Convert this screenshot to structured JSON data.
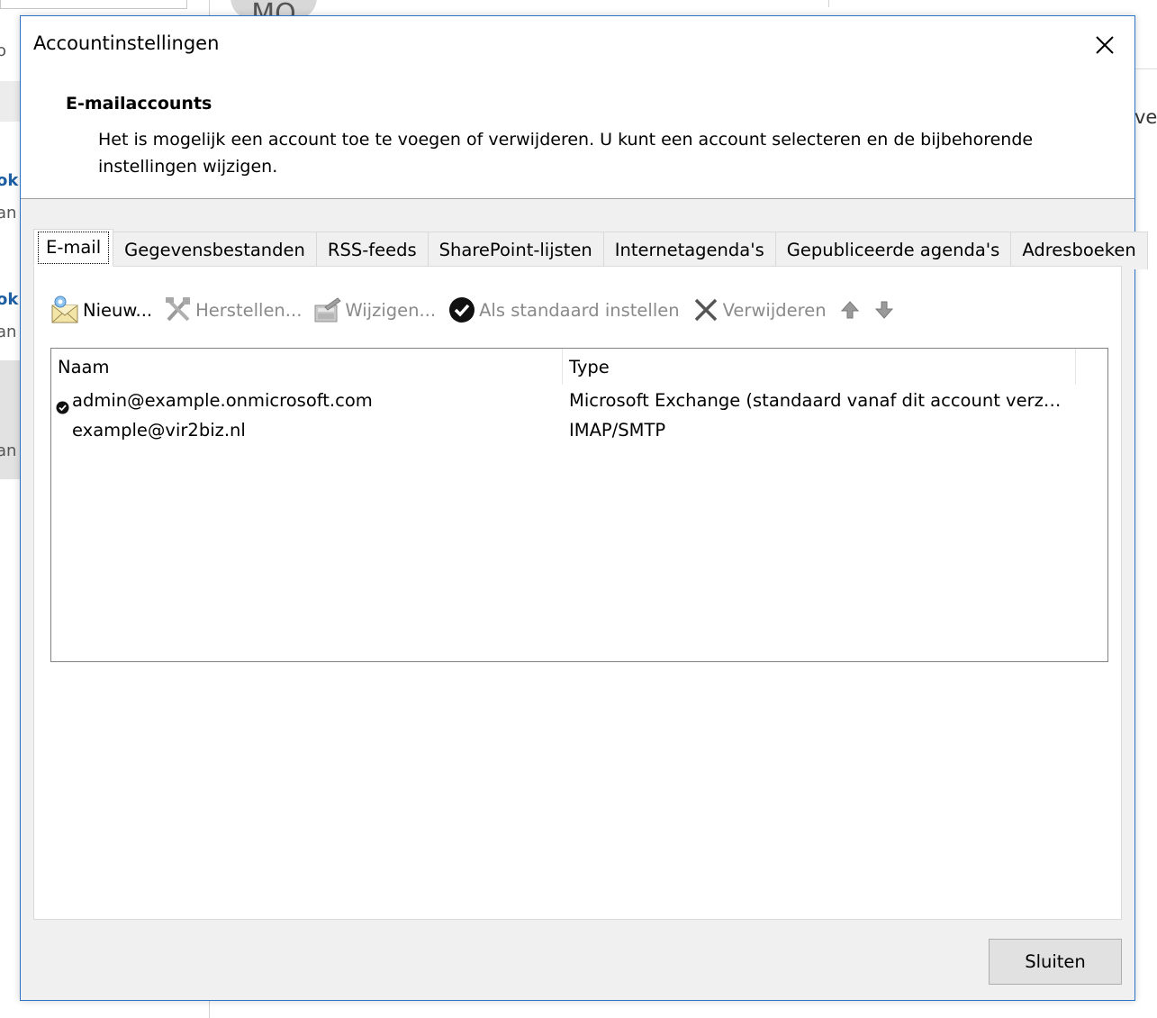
{
  "background": {
    "avatar_initials": "MO",
    "left_fragments": [
      "o",
      "ok",
      "an",
      "ok",
      "an",
      "an"
    ],
    "right_fragment": "ve"
  },
  "dialog": {
    "title": "Accountinstellingen",
    "header_title": "E-mailaccounts",
    "header_description": "Het is mogelijk een account toe te voegen of verwijderen. U kunt een account selecteren en de bijbehorende instellingen wijzigen.",
    "tabs": [
      {
        "label": "E-mail",
        "active": true
      },
      {
        "label": "Gegevensbestanden",
        "active": false
      },
      {
        "label": "RSS-feeds",
        "active": false
      },
      {
        "label": "SharePoint-lijsten",
        "active": false
      },
      {
        "label": "Internetagenda's",
        "active": false
      },
      {
        "label": "Gepubliceerde agenda's",
        "active": false
      },
      {
        "label": "Adresboeken",
        "active": false
      }
    ],
    "toolbar": {
      "new_label": "Nieuw...",
      "repair_label": "Herstellen...",
      "change_label": "Wijzigen...",
      "set_default_label": "Als standaard instellen",
      "remove_label": "Verwijderen"
    },
    "list": {
      "columns": [
        "Naam",
        "Type"
      ],
      "rows": [
        {
          "name": "admin@example.onmicrosoft.com",
          "type": "Microsoft Exchange (standaard vanaf dit account verzend...",
          "is_default": true
        },
        {
          "name": "example@vir2biz.nl",
          "type": "IMAP/SMTP",
          "is_default": false
        }
      ]
    },
    "close_button_label": "Sluiten"
  },
  "colors": {
    "dialog_border": "#2b74c8",
    "dialog_background": "#f0f0f0",
    "disabled_text": "#8a8a8a"
  }
}
